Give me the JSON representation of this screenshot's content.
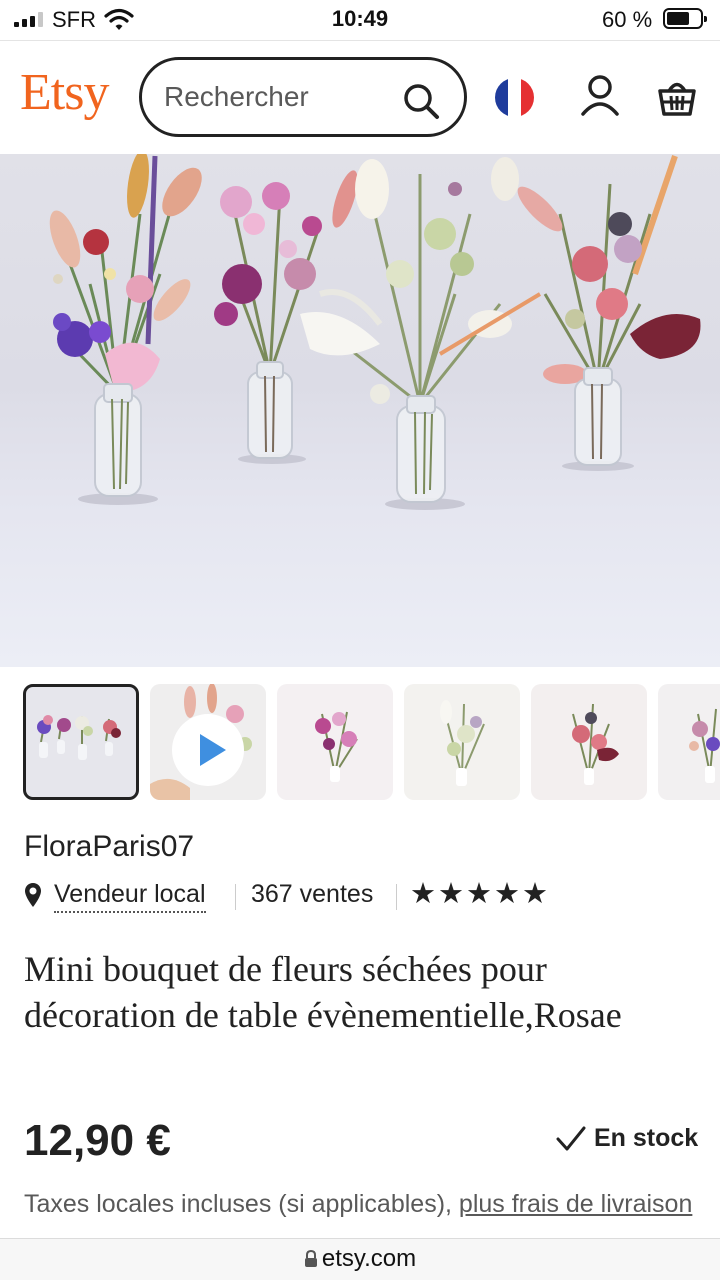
{
  "status_bar": {
    "carrier": "SFR",
    "time": "10:49",
    "battery": "60 %",
    "battery_level": 0.6
  },
  "header": {
    "logo": "Etsy",
    "search_placeholder": "Rechercher",
    "icons": [
      "search-icon",
      "flag-fr-icon",
      "user-icon",
      "basket-icon"
    ],
    "accent_color": "#f1641e"
  },
  "gallery": {
    "thumbnail_count": 6,
    "selected_index": 0,
    "video_thumbnail_index": 1
  },
  "product": {
    "shop_name": "FloraParis07",
    "local_label": "Vendeur local",
    "sales": "367 ventes",
    "rating_stars": 5,
    "stars_text": "★★★★★",
    "title": "Mini bouquet de fleurs séchées pour décoration de table évènementielle,Rosae",
    "price": "12,90 €",
    "stock": "En stock",
    "tax_text": "Taxes locales incluses (si applicables), ",
    "shipping_link": "plus frais de livraison"
  },
  "browser": {
    "url": "etsy.com"
  }
}
